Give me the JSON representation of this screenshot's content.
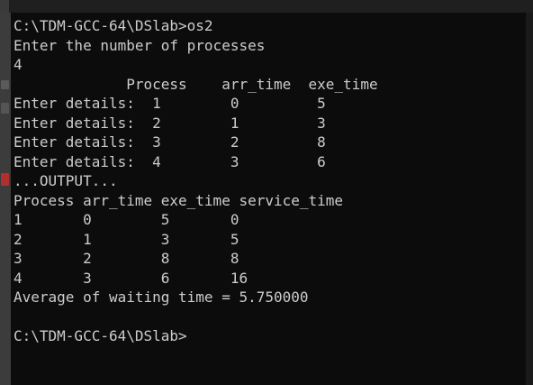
{
  "console": {
    "lines": [
      "C:\\TDM-GCC-64\\DSlab>os2",
      "Enter the number of processes",
      "4",
      "             Process    arr_time  exe_time",
      "Enter details:  1        0         5",
      "Enter details:  2        1         3",
      "Enter details:  3        2         8",
      "Enter details:  4        3         6",
      "...OUTPUT...",
      "Process arr_time exe_time service_time",
      "1       0        5       0",
      "2       1        3       5",
      "3       2        8       8",
      "4       3        6       16",
      "Average of waiting time = 5.750000",
      "",
      "C:\\TDM-GCC-64\\DSlab>"
    ]
  },
  "colors": {
    "console_bg": "#0c0c0c",
    "console_text": "#cccccc",
    "gutter_red": "#b03030"
  }
}
